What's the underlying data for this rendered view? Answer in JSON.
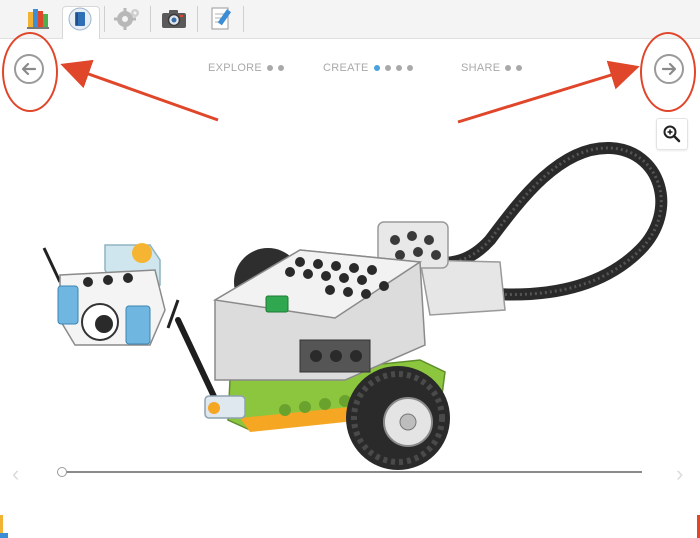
{
  "toolbar": {
    "items": [
      {
        "name": "lobby-icon"
      },
      {
        "name": "project-book-icon"
      },
      {
        "name": "gear-icon"
      },
      {
        "name": "camera-icon"
      },
      {
        "name": "documentation-icon"
      }
    ]
  },
  "steps": [
    {
      "label": "EXPLORE",
      "dots": 2,
      "active_dot": -1
    },
    {
      "label": "CREATE",
      "dots": 4,
      "active_dot": 0
    },
    {
      "label": "SHARE",
      "dots": 2,
      "active_dot": -1
    }
  ],
  "navigation": {
    "previous_icon": "arrow-left-icon",
    "next_icon": "arrow-right-icon"
  },
  "annotations": {
    "color": "#e0462a"
  },
  "zoom": {
    "icon": "zoom-in-icon"
  },
  "slider": {
    "position_fraction": 0.0
  },
  "colors": {
    "accent": "#4aa3df",
    "muted": "#a9a9a9"
  }
}
